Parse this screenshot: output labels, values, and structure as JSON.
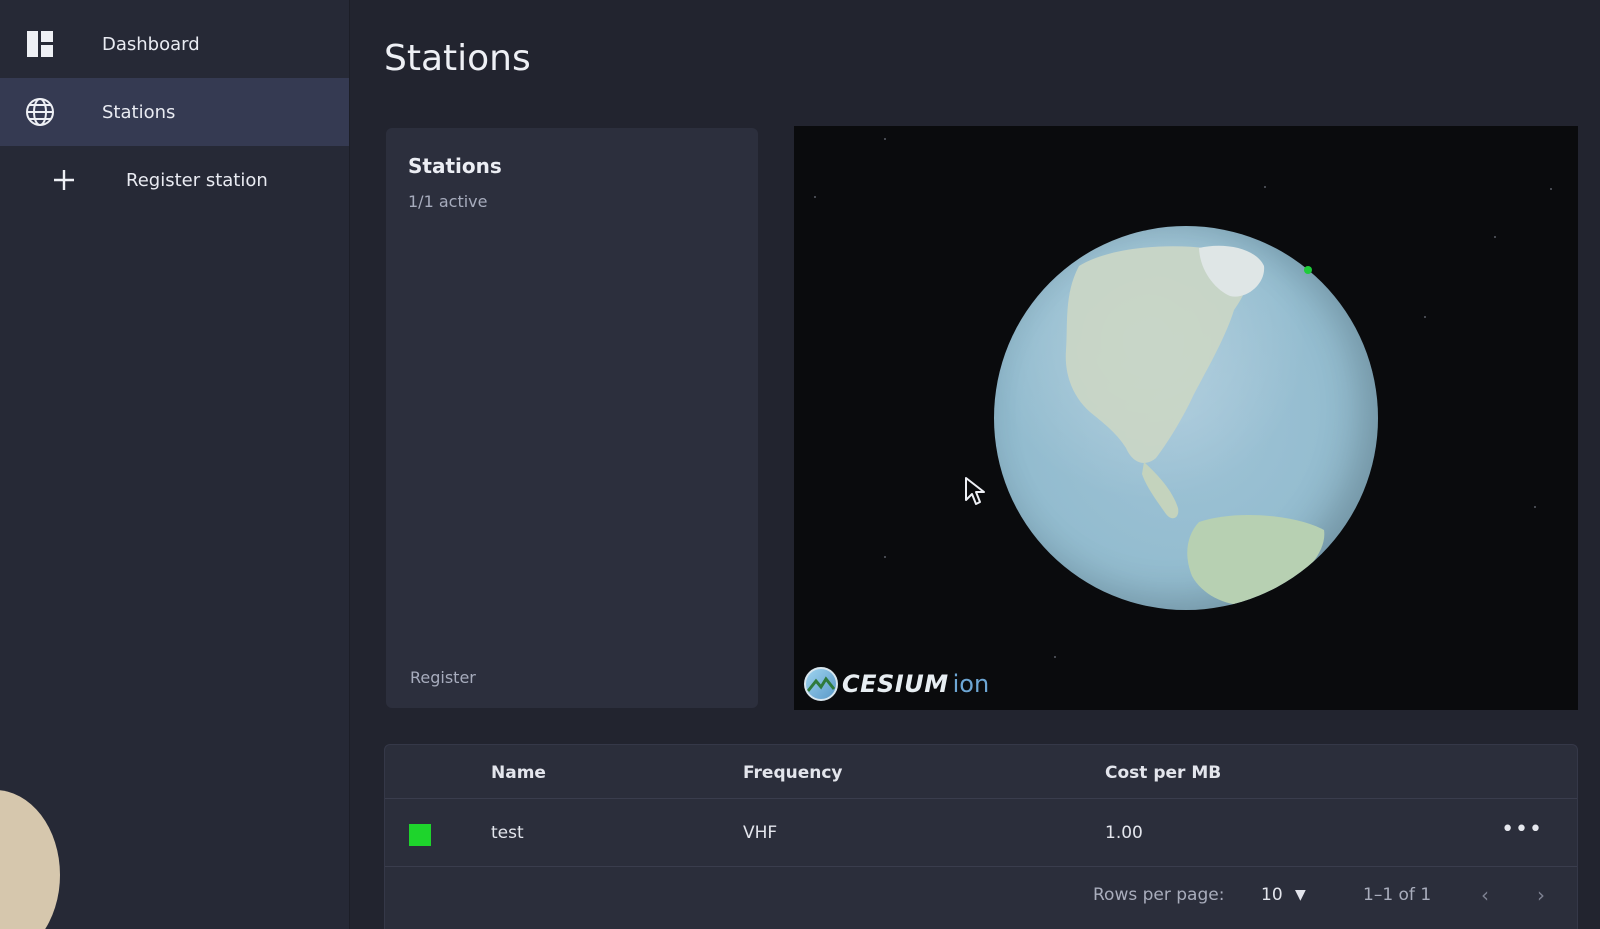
{
  "sidebar": {
    "items": [
      {
        "label": "Dashboard",
        "icon": "dashboard-icon"
      },
      {
        "label": "Stations",
        "icon": "globe-icon",
        "active": true
      },
      {
        "label": "Register station",
        "icon": "plus-icon"
      }
    ]
  },
  "page": {
    "title": "Stations"
  },
  "summary_card": {
    "title": "Stations",
    "subtitle": "1/1 active",
    "link": "Register"
  },
  "map": {
    "logo_text": "CESIUM",
    "logo_suffix": "ion",
    "station_color": "#1ecc3a"
  },
  "table": {
    "columns": [
      "Name",
      "Frequency",
      "Cost per MB"
    ],
    "rows": [
      {
        "status_color": "#1ed42c",
        "name": "test",
        "frequency": "VHF",
        "cost": "1.00",
        "actions": "•••"
      }
    ],
    "pagination": {
      "rows_per_page_label": "Rows per page:",
      "rows_per_page": "10",
      "range": "1–1 of 1",
      "prev": "‹",
      "next": "›"
    }
  }
}
